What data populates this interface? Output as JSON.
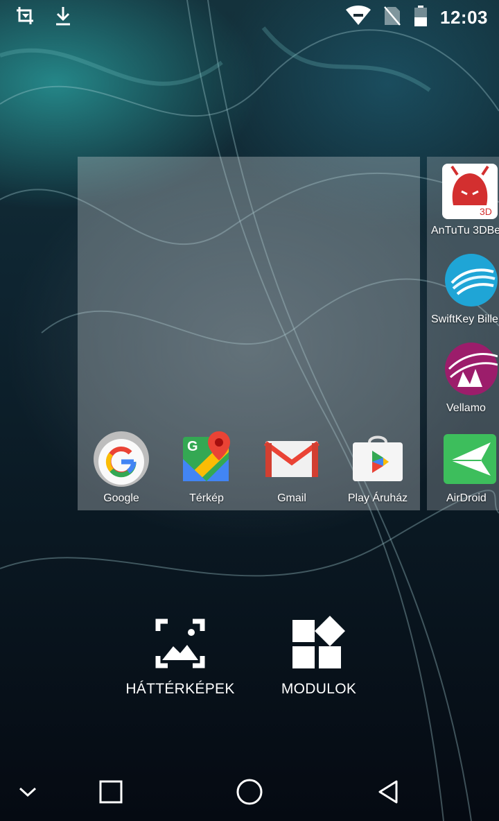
{
  "status_bar": {
    "time": "12:03",
    "left_icons": [
      "screenshot-icon",
      "download-icon"
    ],
    "right_icons": [
      "wifi-icon",
      "no-sim-icon",
      "battery-icon"
    ]
  },
  "home_panel": {
    "apps": [
      {
        "label": "Google",
        "icon": "google-icon"
      },
      {
        "label": "Térkép",
        "icon": "maps-icon"
      },
      {
        "label": "Gmail",
        "icon": "gmail-icon"
      },
      {
        "label": "Play Áruház",
        "icon": "play-store-icon"
      }
    ]
  },
  "side_panel": {
    "apps": [
      {
        "label": "AnTuTu 3DBe",
        "icon": "antutu-icon"
      },
      {
        "label": "SwiftKey Bille",
        "icon": "swiftkey-icon"
      },
      {
        "label": "Vellamo",
        "icon": "vellamo-icon"
      },
      {
        "label": "AirDroid",
        "icon": "airdroid-icon"
      }
    ]
  },
  "options": {
    "wallpapers_label": "HÁTTÉRKÉPEK",
    "widgets_label": "MODULOK"
  },
  "nav_bar": {
    "icons": [
      "hide-keyboard-icon",
      "recents-icon",
      "home-icon",
      "back-icon"
    ]
  },
  "colors": {
    "google_blue": "#4285F4",
    "google_red": "#EA4335",
    "google_yellow": "#FBBC05",
    "google_green": "#34A853",
    "airdroid_green": "#3DBE5C"
  }
}
